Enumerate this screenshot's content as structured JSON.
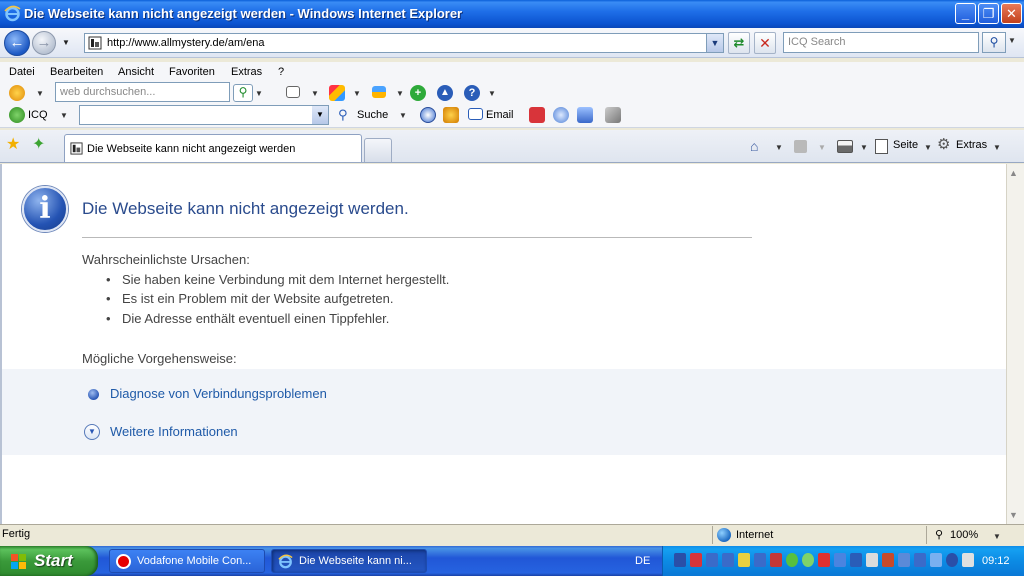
{
  "window": {
    "title": "Die Webseite kann nicht angezeigt werden - Windows Internet Explorer",
    "minimize_glyph": "_",
    "maximize_glyph": "❐",
    "close_glyph": "✕"
  },
  "address_bar": {
    "url": "http://www.allmystery.de/am/ena"
  },
  "search_box": {
    "placeholder": "ICQ Search"
  },
  "menu": {
    "items": [
      "Datei",
      "Bearbeiten",
      "Ansicht",
      "Favoriten",
      "Extras",
      "?"
    ]
  },
  "toolbar1": {
    "search_placeholder": "web durchsuchen..."
  },
  "toolbar2": {
    "icq_label": "ICQ",
    "suche_label": "Suche",
    "email_label": "Email"
  },
  "tabs": {
    "active_label": "Die Webseite kann nicht angezeigt werden"
  },
  "command_bar": {
    "seite_label": "Seite",
    "extras_label": "Extras"
  },
  "error_page": {
    "title": "Die Webseite kann nicht angezeigt werden.",
    "causes_heading": "Wahrscheinlichste Ursachen:",
    "causes": [
      "Sie haben keine Verbindung mit dem Internet hergestellt.",
      "Es ist ein Problem mit der Website aufgetreten.",
      "Die Adresse enthält eventuell einen Tippfehler."
    ],
    "actions_heading": "Mögliche Vorgehensweise:",
    "diagnose_link": "Diagnose von Verbindungsproblemen",
    "more_info_link": "Weitere Informationen"
  },
  "status_bar": {
    "status": "Fertig",
    "zone": "Internet",
    "zoom": "100%"
  },
  "taskbar": {
    "start_label": "Start",
    "tasks": [
      {
        "label": "Vodafone Mobile Con..."
      },
      {
        "label": "Die Webseite kann ni..."
      }
    ],
    "language": "DE",
    "clock": "09:12"
  },
  "colors": {
    "titlebar": "#0b53d0",
    "link": "#1f5aa8",
    "error_title": "#2a4b8d",
    "start_green": "#3a9a3a"
  }
}
